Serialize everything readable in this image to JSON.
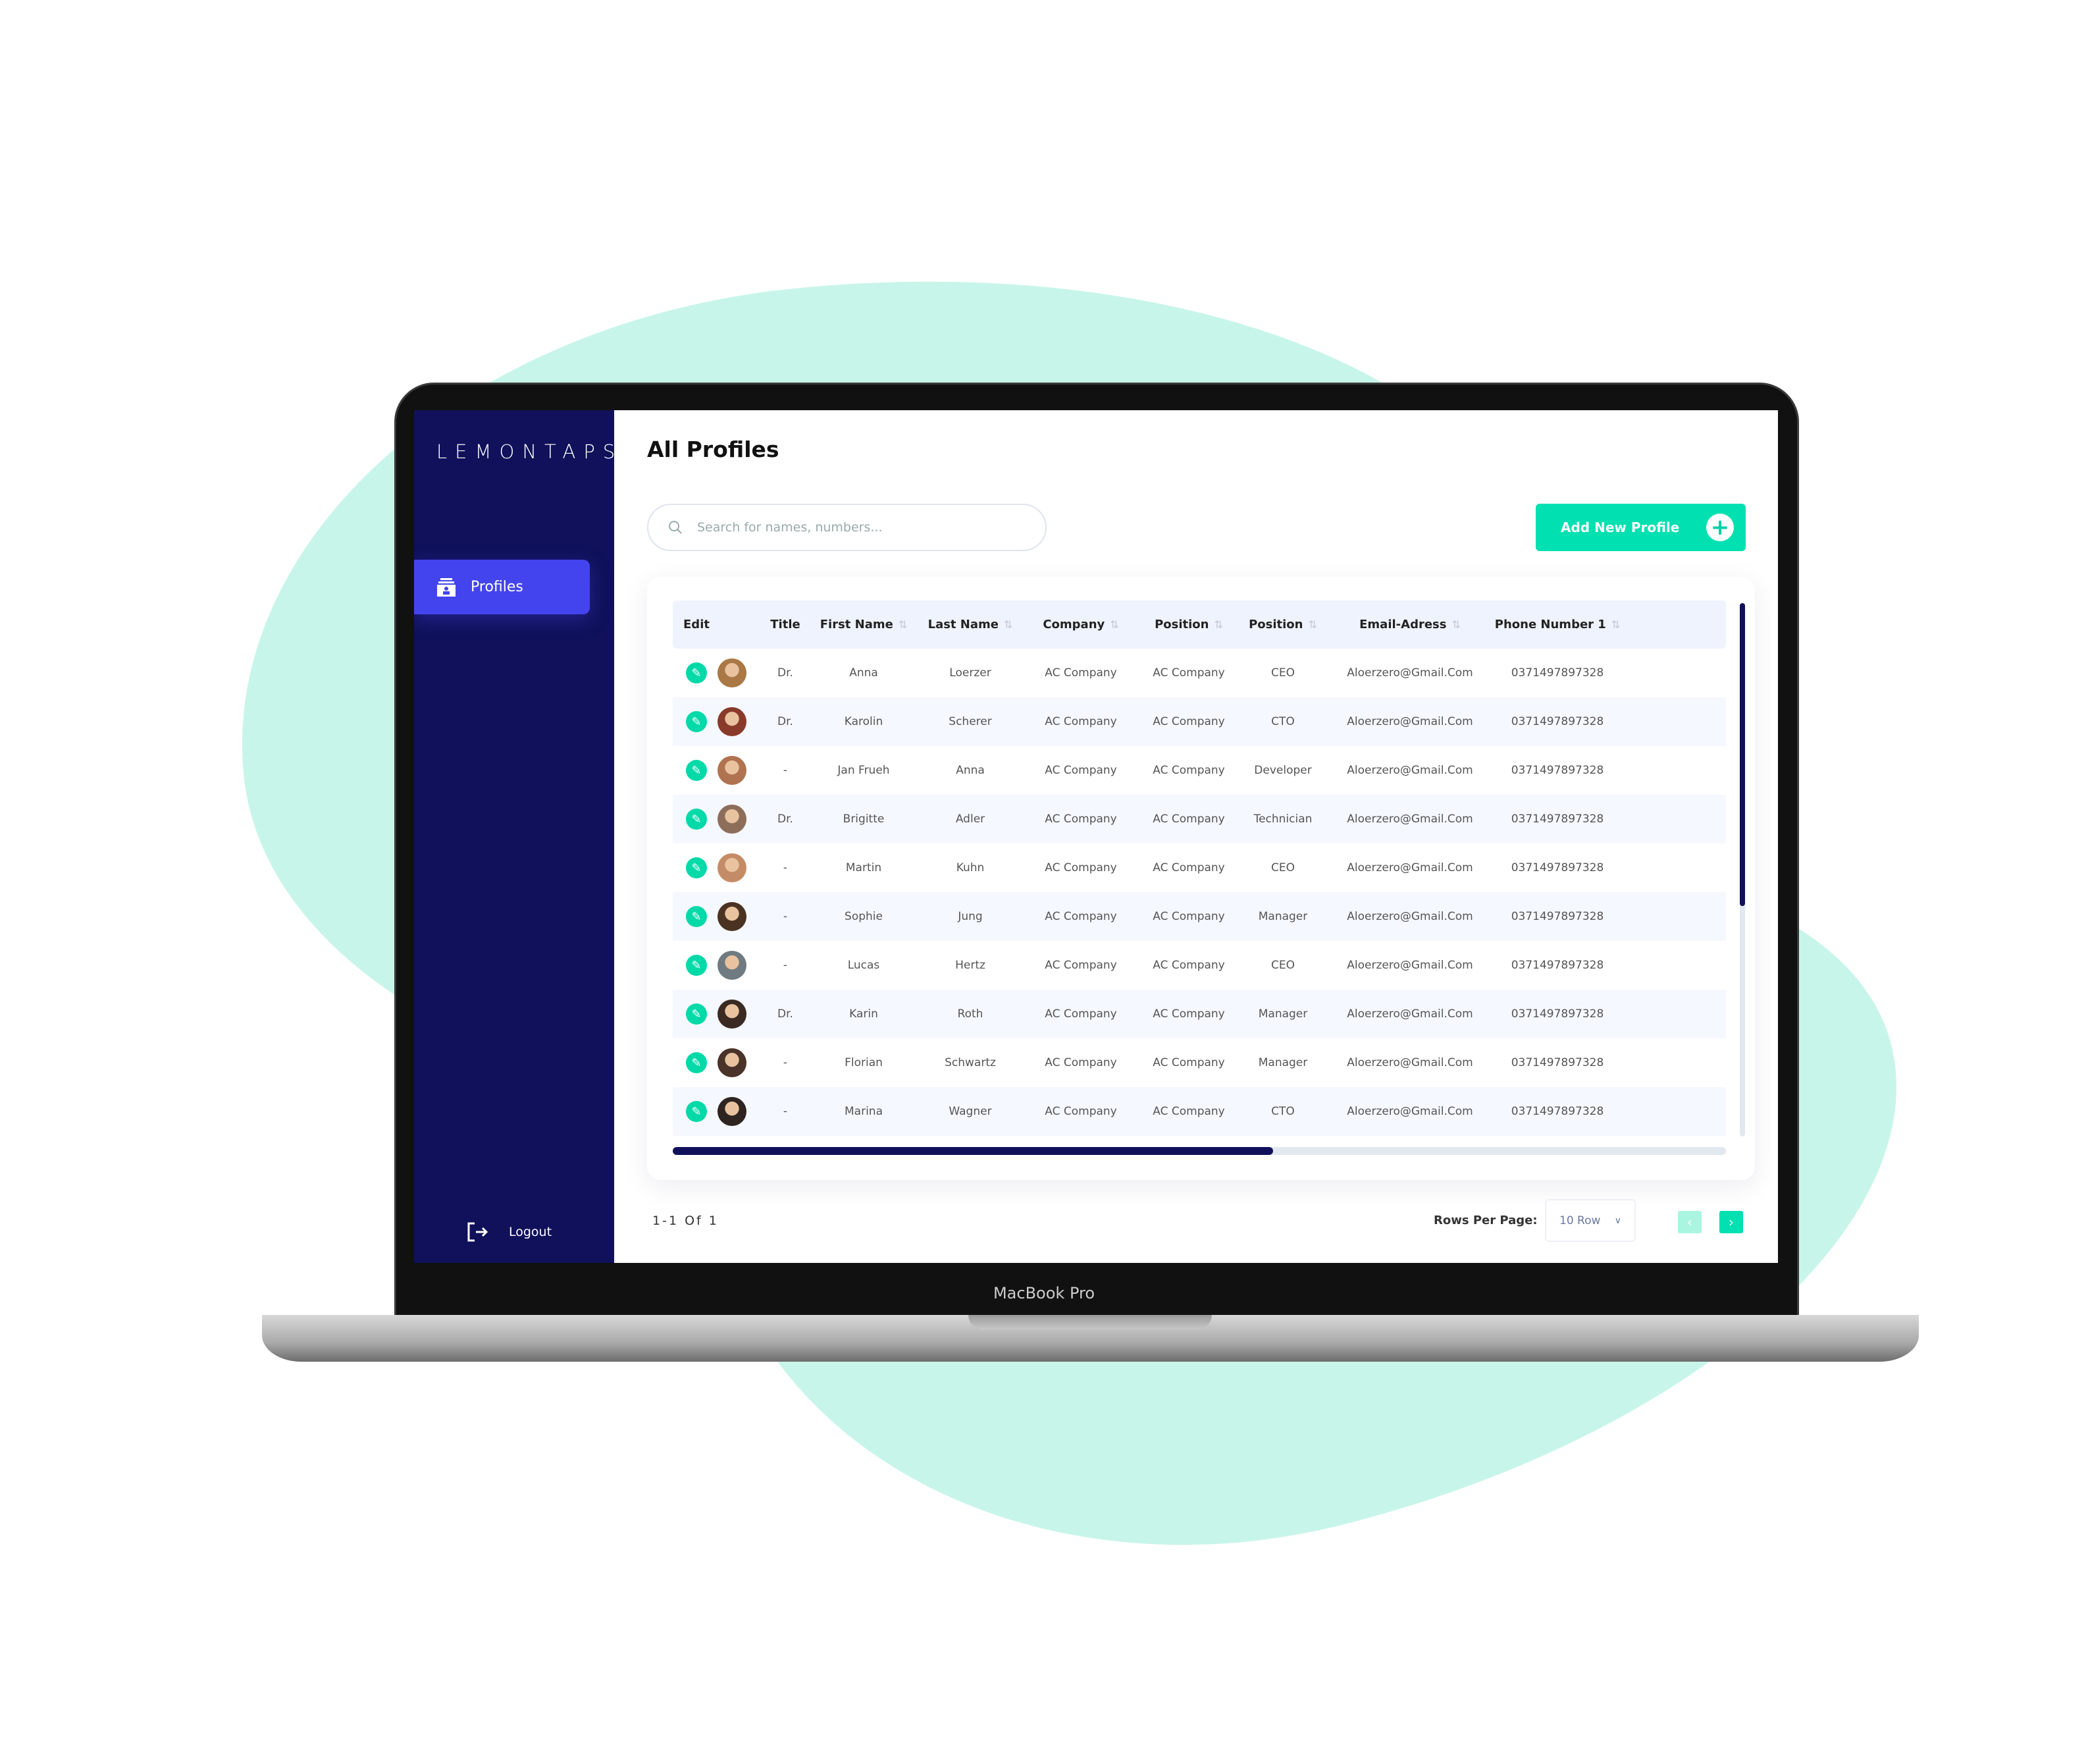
{
  "brand": {
    "logo": "LEMONTAPS",
    "device": "MacBook Pro"
  },
  "colors": {
    "sidebar": "#10115a",
    "accent": "#4444ee",
    "primary": "#00e0b0",
    "blob": "#c8f5ea"
  },
  "sidebar": {
    "items": [
      {
        "label": "Profiles",
        "icon": "profile-card-icon",
        "active": true
      }
    ],
    "logout": "Logout"
  },
  "header": {
    "title": "All Profiles"
  },
  "search": {
    "placeholder": "Search for names, numbers...",
    "value": ""
  },
  "add_button": {
    "label": "Add New Profile"
  },
  "table": {
    "columns": [
      {
        "label": "Edit",
        "sortable": false
      },
      {
        "label": "",
        "sortable": false
      },
      {
        "label": "Title",
        "sortable": false
      },
      {
        "label": "First Name",
        "sortable": true
      },
      {
        "label": "Last Name",
        "sortable": true
      },
      {
        "label": "Company",
        "sortable": true
      },
      {
        "label": "Position",
        "sortable": true
      },
      {
        "label": "Position",
        "sortable": true
      },
      {
        "label": "Email-Adress",
        "sortable": true
      },
      {
        "label": "Phone Number 1",
        "sortable": true
      }
    ],
    "rows": [
      [
        "Dr.",
        "Anna",
        "Loerzer",
        "AC Company",
        "AC Company",
        "CEO",
        "Aloerzero@Gmail.Com",
        "0371497897328"
      ],
      [
        "Dr.",
        "Karolin",
        "Scherer",
        "AC Company",
        "AC Company",
        "CTO",
        "Aloerzero@Gmail.Com",
        "0371497897328"
      ],
      [
        "-",
        "Jan Frueh",
        "Anna",
        "AC Company",
        "AC Company",
        "Developer",
        "Aloerzero@Gmail.Com",
        "0371497897328"
      ],
      [
        "Dr.",
        "Brigitte",
        "Adler",
        "AC Company",
        "AC Company",
        "Technician",
        "Aloerzero@Gmail.Com",
        "0371497897328"
      ],
      [
        "-",
        "Martin",
        "Kuhn",
        "AC Company",
        "AC Company",
        "CEO",
        "Aloerzero@Gmail.Com",
        "0371497897328"
      ],
      [
        "-",
        "Sophie",
        "Jung",
        "AC Company",
        "AC Company",
        "Manager",
        "Aloerzero@Gmail.Com",
        "0371497897328"
      ],
      [
        "-",
        "Lucas",
        "Hertz",
        "AC Company",
        "AC Company",
        "CEO",
        "Aloerzero@Gmail.Com",
        "0371497897328"
      ],
      [
        "Dr.",
        "Karin",
        "Roth",
        "AC Company",
        "AC Company",
        "Manager",
        "Aloerzero@Gmail.Com",
        "0371497897328"
      ],
      [
        "-",
        "Florian",
        "Schwartz",
        "AC Company",
        "AC Company",
        "Manager",
        "Aloerzero@Gmail.Com",
        "0371497897328"
      ],
      [
        "-",
        "Marina",
        "Wagner",
        "AC Company",
        "AC Company",
        "CTO",
        "Aloerzero@Gmail.Com",
        "0371497897328"
      ]
    ],
    "horizontal_scroll_fraction": 0.57,
    "vertical_scroll_fraction": 0.57
  },
  "footer": {
    "page_info": "1-1 Of 1",
    "rows_per_page_label": "Rows Per Page:",
    "rows_per_page_value": "10 Row"
  }
}
